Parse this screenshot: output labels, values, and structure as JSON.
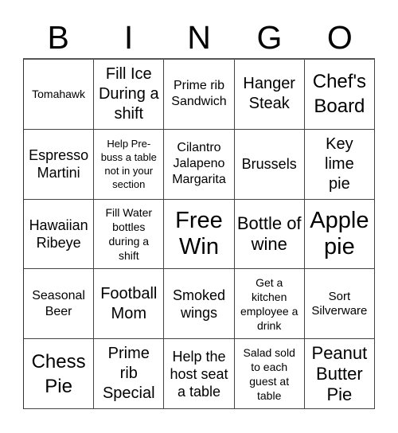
{
  "header": {
    "letters": [
      "B",
      "I",
      "N",
      "G",
      "O"
    ]
  },
  "cells": [
    [
      "Tomahawk",
      "Fill Ice During a shift",
      "Prime rib Sandwich",
      "Hanger Steak",
      "Chef's Board"
    ],
    [
      "Espresso Martini",
      "Help Pre-buss a table not in your section",
      "Cilantro Jalapeno Margarita",
      "Brussels",
      "Key lime pie"
    ],
    [
      "Hawaiian Ribeye",
      "Fill Water bottles during a shift",
      "Free Win",
      "Bottle of wine",
      "Apple pie"
    ],
    [
      "Seasonal Beer",
      "Football Mom",
      "Smoked wings",
      "Get a kitchen employee a drink",
      "Sort Silverware"
    ],
    [
      "Chess Pie",
      "Prime rib Special",
      "Help the host seat a table",
      "Salad sold to each guest at table",
      "Peanut Butter Pie"
    ]
  ]
}
